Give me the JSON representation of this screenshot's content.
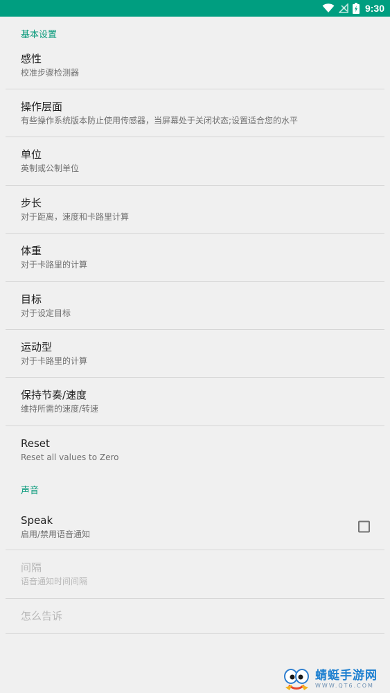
{
  "status_bar": {
    "time": "9:30",
    "icons": [
      "wifi-icon",
      "signal-off-icon",
      "battery-icon"
    ],
    "background": "#009e80"
  },
  "sections": {
    "basic": {
      "header": "基本设置",
      "items": [
        {
          "title": "感性",
          "summary": "校准步骤检测器"
        },
        {
          "title": "操作层面",
          "summary": "有些操作系统版本防止使用传感器，当屏幕处于关闭状态;设置适合您的水平"
        },
        {
          "title": "单位",
          "summary": "英制或公制单位"
        },
        {
          "title": "步长",
          "summary": "对于距离，速度和卡路里计算"
        },
        {
          "title": "体重",
          "summary": "对于卡路里的计算"
        },
        {
          "title": "目标",
          "summary": "对于设定目标"
        },
        {
          "title": "运动型",
          "summary": "对于卡路里的计算"
        },
        {
          "title": "保持节奏/速度",
          "summary": "维持所需的速度/转速"
        },
        {
          "title": "Reset",
          "summary": "Reset all values to Zero"
        }
      ]
    },
    "sound": {
      "header": "声音",
      "items": [
        {
          "title": "Speak",
          "summary": "启用/禁用语音通知",
          "checked": false
        },
        {
          "title": "间隔",
          "summary": "语音通知时间间隔",
          "disabled": true
        },
        {
          "title": "怎么告诉",
          "disabled": true
        }
      ]
    }
  },
  "watermark": {
    "text": "蜻蜓手游网",
    "url": "WWW.QT6.COM"
  },
  "colors": {
    "accent": "#0c9b7d",
    "background": "#f0f0f0",
    "divider": "#d6d6d6"
  }
}
